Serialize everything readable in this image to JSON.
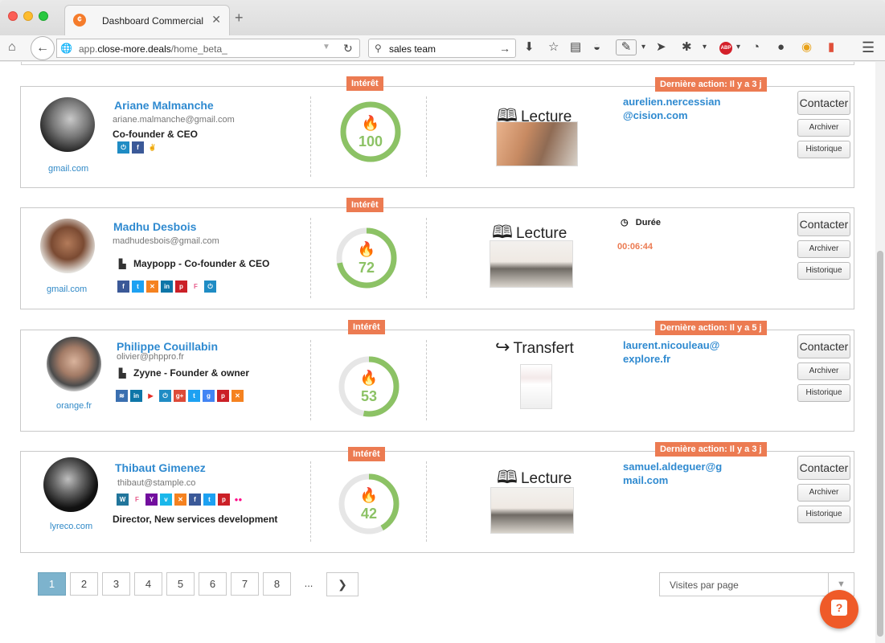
{
  "browser": {
    "tab_title": "Dashboard Commercial",
    "url_prefix": "app.",
    "url_domain": "close-more.deals",
    "url_path": "/home_beta_",
    "search_value": "sales team",
    "abp_label": "ABP"
  },
  "badges": {
    "interet": "Intérêt",
    "derniere_action": "Dernière action: Il y a 3  j",
    "derniere_action_5": "Dernière action: Il y a 5  j"
  },
  "buttons": {
    "contacter": "Contacter",
    "archiver": "Archiver",
    "historique": "Historique"
  },
  "cards": [
    {
      "name": "Ariane Malmanche",
      "email": "ariane.malmanche@gmail.com",
      "role": "Co-founder & CEO",
      "domain": "gmail.com",
      "score": 100,
      "activity": "Lecture",
      "contact_line1": "aurelien.nercessian",
      "contact_line2": "@cision.com"
    },
    {
      "name": "Madhu Desbois",
      "email": "madhudesbois@gmail.com",
      "role": "Maypopp - Co-founder & CEO",
      "domain": "gmail.com",
      "score": 72,
      "activity": "Lecture",
      "duree_label": "Durée",
      "duree_value": "00:06:44"
    },
    {
      "name": "Philippe Couillabin",
      "email": "olivier@phppro.fr",
      "role": "Zyyne - Founder & owner",
      "domain": "orange.fr",
      "score": 53,
      "activity": "Transfert",
      "contact_line1": "laurent.nicouleau@",
      "contact_line2": "explore.fr"
    },
    {
      "name": "Thibaut Gimenez",
      "email": "thibaut@stample.co",
      "role": "Director, New services development",
      "domain": "lyreco.com",
      "score": 42,
      "activity": "Lecture",
      "contact_line1": "samuel.aldeguer@g",
      "contact_line2": "mail.com"
    }
  ],
  "pagination": {
    "pages": [
      "1",
      "2",
      "3",
      "4",
      "5",
      "6",
      "7",
      "8"
    ],
    "ellipsis": "...",
    "visites_label": "Visites par page"
  },
  "colors": {
    "accent_orange": "#ec7b52",
    "link_blue": "#2f8ad0",
    "score_green": "#8cc265"
  }
}
